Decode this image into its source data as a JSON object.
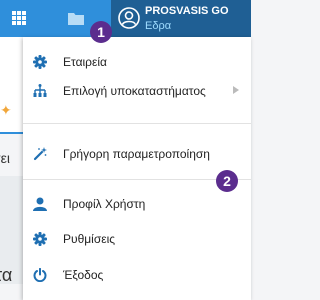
{
  "header": {
    "user_name": "PROSVASIS GO",
    "user_subtitle": "Εδρα",
    "icons": [
      "grid-icon",
      "folder-icon",
      "user-icon"
    ]
  },
  "background": {
    "text_1": "σει",
    "text_2": "τα"
  },
  "menu": {
    "items": [
      {
        "label": "Εταιρεία",
        "icon": "gear-icon"
      },
      {
        "label": "Επιλογή υποκαταστήματος",
        "icon": "hierarchy-icon",
        "has_submenu": true
      },
      {
        "label": "Γρήγορη παραμετροποίηση",
        "icon": "magic-wand-icon"
      },
      {
        "label": "Προφίλ Χρήστη",
        "icon": "person-icon"
      },
      {
        "label": "Ρυθμίσεις",
        "icon": "gear-icon"
      },
      {
        "label": "Έξοδος",
        "icon": "power-icon"
      }
    ]
  },
  "callouts": [
    "1",
    "2"
  ],
  "colors": {
    "topbar": "#2f8fdb",
    "user_area": "#1f5f94",
    "icon_blue": "#1f6fb2",
    "callout": "#5b2d8e",
    "subtitle": "#9fdcff"
  }
}
